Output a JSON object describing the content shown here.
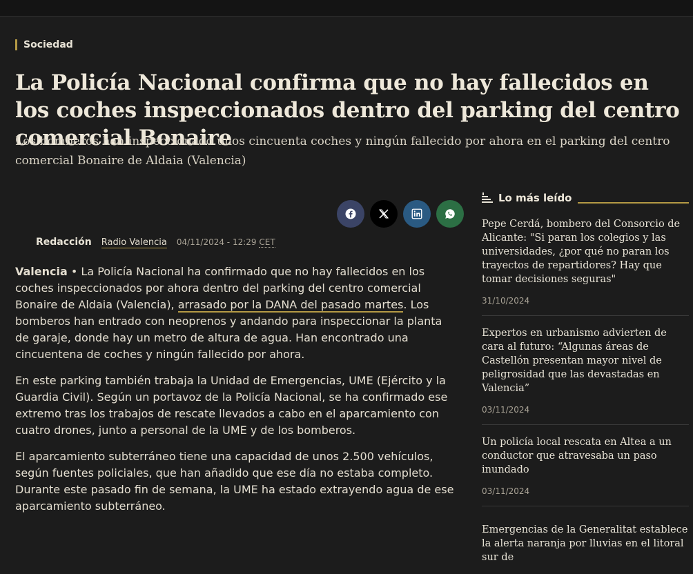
{
  "article": {
    "category": "Sociedad",
    "headline": "La Policía Nacional confirma que no hay fallecidos en los coches inspeccionados dentro del parking del centro comercial Bonaire",
    "subtitle": "Los bomberos han inspeccionado unos cincuenta coches y ningún fallecido por ahora en el parking del centro comercial Bonaire de Aldaia (Valencia)",
    "author": "Redacción",
    "source": "Radio Valencia",
    "date": "04/11/2024 - 12:29",
    "timezone": "CET",
    "p1": {
      "location": "Valencia",
      "bullet": " • ",
      "text_before": "La Policía Nacional ha confirmado que no hay fallecidos en los coches inspeccionados por ahora dentro del parking del centro comercial Bonaire de Aldaia (Valencia), ",
      "link": "arrasado por la DANA del pasado martes",
      "text_after": ". Los bomberos han entrado con neoprenos y andando para inspeccionar la planta de garaje, donde hay un metro de altura de agua. Han encontrado una cincuentena de coches y ningún fallecido por ahora."
    },
    "p2": "En este parking también trabaja la Unidad de Emergencias, UME (Ejército y la Guardia Civil). Según un portavoz de la Policía Nacional, se ha confirmado ese extremo tras los trabajos de rescate llevados a cabo en el aparcamiento con cuatro drones, junto a personal de la UME y de los bomberos.",
    "p3": "El aparcamiento subterráneo tiene una capacidad de unos 2.500 vehículos, según fuentes policiales, que han añadido que ese día no estaba completo. Durante este pasado fin de semana, la UME ha estado extrayendo agua de ese aparcamiento subterráneo."
  },
  "share": {
    "icons": [
      "facebook-icon",
      "x-icon",
      "linkedin-icon",
      "whatsapp-icon"
    ]
  },
  "sidebar": {
    "title": "Lo más leído",
    "items": [
      {
        "title": "Pepe Cerdá, bombero del Consorcio de Alicante: \"Si paran los colegios y las universidades, ¿por qué no paran los trayectos de repartidores? Hay que tomar decisiones seguras\"",
        "date": "31/10/2024"
      },
      {
        "title": "Expertos en urbanismo advierten de cara al futuro: “Algunas áreas de Castellón presentan mayor nivel de peligrosidad que las devastadas en Valencia”",
        "date": "03/11/2024"
      },
      {
        "title": "Un policía local rescata en Altea a un conductor que atravesaba un paso inundado",
        "date": "03/11/2024"
      },
      {
        "title": "Emergencias de la Generalitat establece la alerta naranja por lluvias en el litoral sur de",
        "date": ""
      }
    ]
  },
  "colors": {
    "background": "#1c1c1c",
    "accent": "#b59a45",
    "text": "#e8e3d6"
  }
}
